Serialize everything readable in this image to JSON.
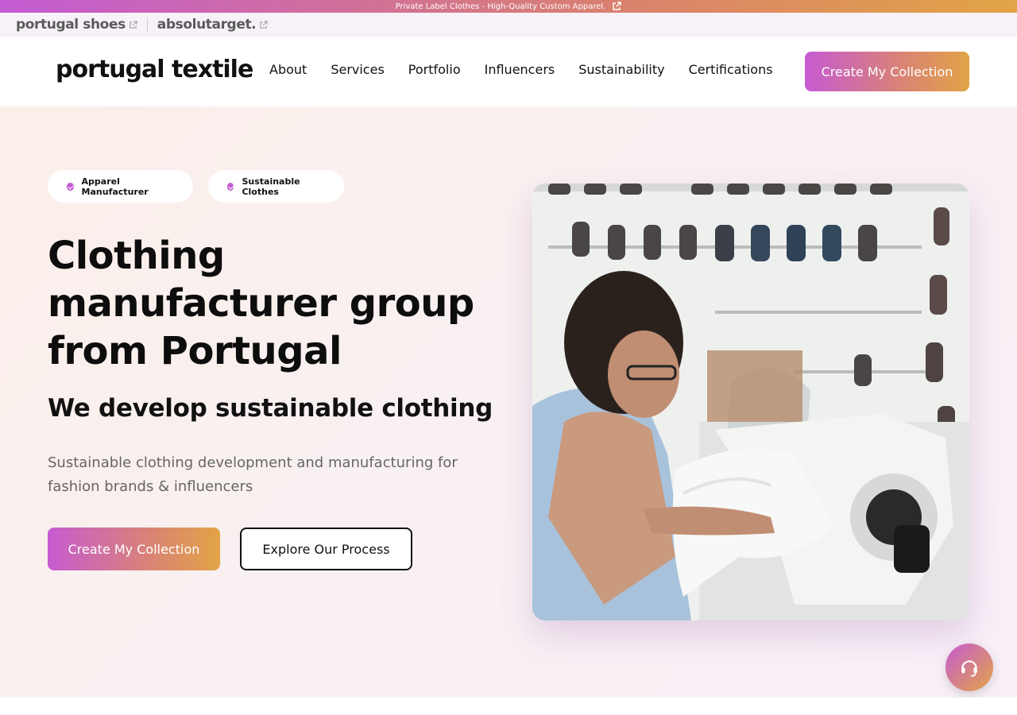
{
  "promo": {
    "text": "Private Label Clothes - High-Quality Custom Apparel."
  },
  "brands": [
    {
      "label": "portugal shoes"
    },
    {
      "label": "absolutarget."
    }
  ],
  "header": {
    "logo": "portugal textile",
    "nav": [
      "About",
      "Services",
      "Portfolio",
      "Influencers",
      "Sustainability",
      "Certifications"
    ],
    "cta": "Create My Collection"
  },
  "hero": {
    "badges": [
      "Apparel Manufacturer",
      "Sustainable Clothes"
    ],
    "title": "Clothing manufacturer group from Portugal",
    "subtitle": "We develop sustainable clothing",
    "description": "Sustainable clothing development and manufacturing for fashion brands & influencers",
    "primary_cta": "Create My Collection",
    "secondary_cta": "Explore Our Process"
  },
  "colors": {
    "accent_start": "#c65bd1",
    "accent_end": "#e2a446"
  },
  "icons": {
    "external_link": "external-link-icon",
    "check": "check-icon",
    "support": "headset-icon"
  }
}
